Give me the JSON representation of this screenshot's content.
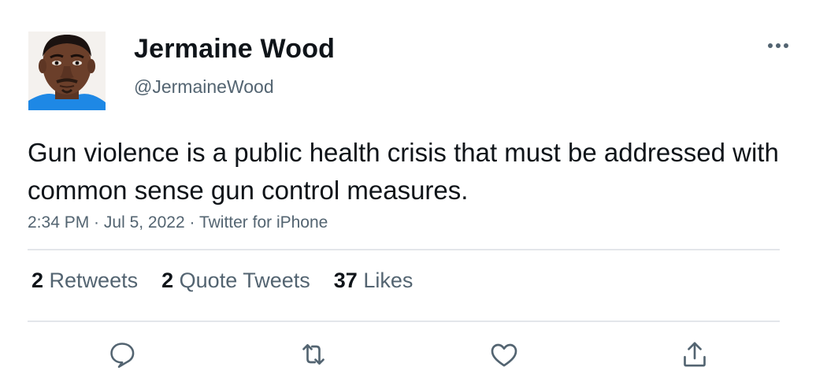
{
  "author": {
    "name": "Jermaine Wood",
    "handle": "@JermaineWood",
    "avatar": "profile-photo"
  },
  "tweet": {
    "text": "Gun violence is a public health crisis that must be addressed with common sense gun control measures."
  },
  "meta": {
    "time": "2:34 PM",
    "separator": " · ",
    "date": "Jul 5, 2022",
    "source": "Twitter for iPhone"
  },
  "stats": {
    "retweets": {
      "count": "2",
      "label": "Retweets"
    },
    "quotes": {
      "count": "2",
      "label": "Quote Tweets"
    },
    "likes": {
      "count": "37",
      "label": "Likes"
    }
  },
  "actions": {
    "reply": "reply-icon",
    "retweet": "retweet-icon",
    "like": "heart-icon",
    "share": "share-icon"
  },
  "colors": {
    "text": "#0f1419",
    "secondary": "#536471",
    "divider": "#e3e6ea",
    "icon": "#536471"
  }
}
